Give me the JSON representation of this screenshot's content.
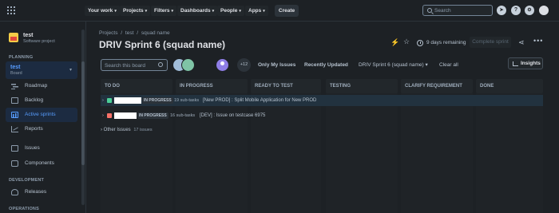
{
  "topnav": {
    "your_work": "Your work",
    "projects": "Projects",
    "filters": "Filters",
    "dashboards": "Dashboards",
    "people": "People",
    "apps": "Apps",
    "create": "Create",
    "search_placeholder": "Search",
    "icon_help": "?"
  },
  "sidebar": {
    "project_name": "test",
    "project_type": "Software project",
    "planning_label": "PLANNING",
    "board_title": "test",
    "board_subtitle": "Board",
    "roadmap": "Roadmap",
    "backlog": "Backlog",
    "active_sprints": "Active sprints",
    "reports": "Reports",
    "issues": "Issues",
    "components": "Components",
    "development_label": "DEVELOPMENT",
    "releases": "Releases",
    "operations_label": "OPERATIONS"
  },
  "header": {
    "breadcrumb": [
      "Projects",
      "/",
      "test",
      "/",
      "squad name"
    ],
    "title": "DRIV Sprint 6 (squad name)",
    "remaining": "9 days remaining",
    "complete_sprint": "Complete sprint"
  },
  "filters": {
    "search_placeholder": "Search this board",
    "more_count": "+12",
    "only_my_issues": "Only My Issues",
    "recently_updated": "Recently Updated",
    "sprint_select": "DRIV Sprint 6 (squad name)",
    "clear_all": "Clear all",
    "insights": "Insights"
  },
  "columns": [
    "TO DO",
    "IN PROGRESS",
    "READY TO TEST",
    "TESTING",
    "CLARIFY REQUIREMENT",
    "DONE"
  ],
  "swimlanes": [
    {
      "status": "IN PROGRESS",
      "subtasks": "19 sub-tasks",
      "summary": "[New PROD] : Split Mobile Application for New PROD",
      "tag_color": "#4bce97"
    },
    {
      "status": "IN PROGRESS",
      "subtasks": "16 sub-tasks",
      "summary": "[DEV] : Issue on testcase 6975",
      "tag_color": "#f87168"
    }
  ],
  "other_issues": {
    "label": "Other Issues",
    "count": "17 issues"
  },
  "colors": {
    "background": "#1d2125",
    "accent": "#579dff",
    "selected_bg": "#1c2b41"
  }
}
